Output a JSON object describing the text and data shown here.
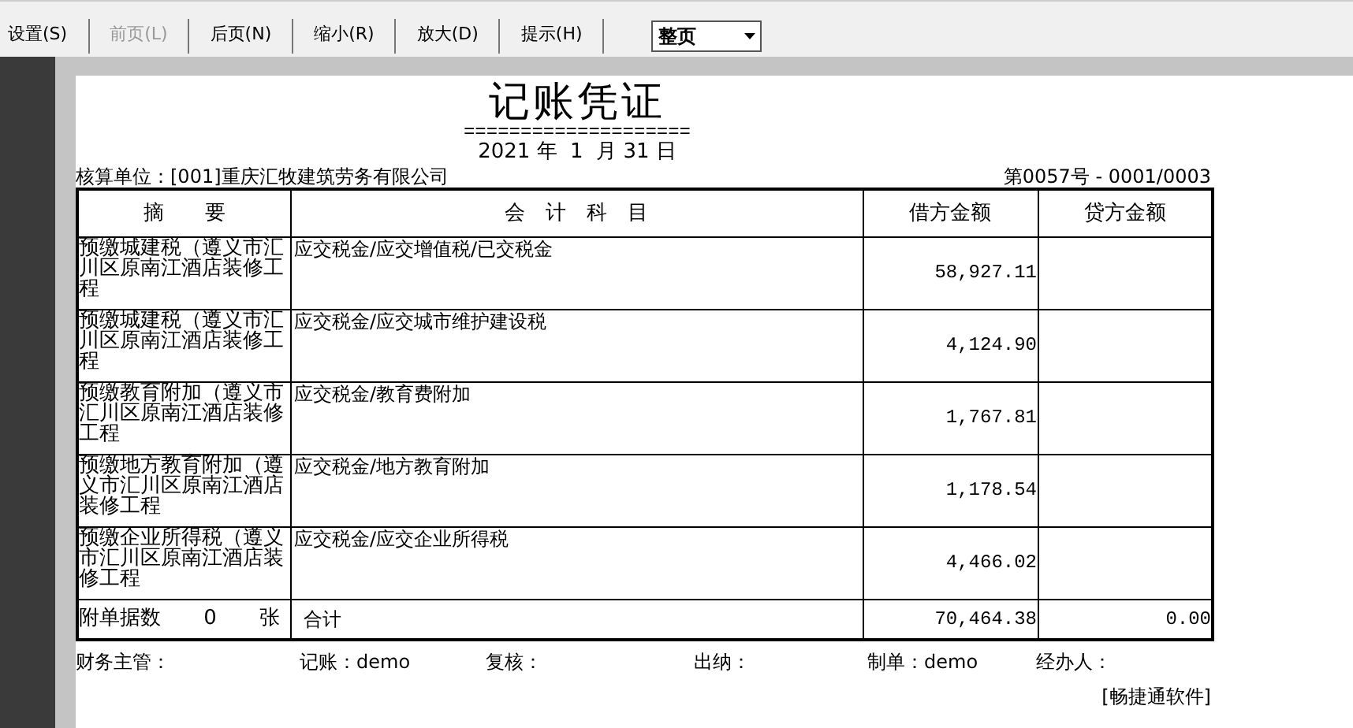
{
  "toolbar": {
    "buttons": [
      {
        "label": "设置(S)",
        "disabled": false
      },
      {
        "label": "前页(L)",
        "disabled": true
      },
      {
        "label": "后页(N)",
        "disabled": false
      },
      {
        "label": "缩小(R)",
        "disabled": false
      },
      {
        "label": "放大(D)",
        "disabled": false
      },
      {
        "label": "提示(H)",
        "disabled": false
      }
    ],
    "zoom_select": {
      "value": "整页"
    }
  },
  "voucher": {
    "title": "记账凭证",
    "title_rule": "====================",
    "date": "2021 年  1  月 31 日",
    "unit": "核算单位：[001]重庆汇牧建筑劳务有限公司",
    "number": "第0057号 - 0001/0003",
    "columns": [
      "摘　　要",
      "会　计　科　目",
      "借方金额",
      "贷方金额"
    ],
    "rows": [
      {
        "summary": "预缴城建税（遵义市汇川区原南江酒店装修工程",
        "account": "应交税金/应交增值税/已交税金",
        "debit": "58,927.11"
      },
      {
        "summary": "预缴城建税（遵义市汇川区原南江酒店装修工程",
        "account": "应交税金/应交城市维护建设税",
        "debit": "4,124.90"
      },
      {
        "summary": "预缴教育附加（遵义市汇川区原南江酒店装修工程",
        "account": "应交税金/教育费附加",
        "debit": "1,767.81"
      },
      {
        "summary": "预缴地方教育附加（遵义市汇川区原南江酒店装修工程",
        "account": "应交税金/地方教育附加",
        "debit": "1,178.54"
      },
      {
        "summary": "预缴企业所得税（遵义市汇川区原南江酒店装修工程",
        "account": "应交税金/应交企业所得税",
        "debit": "4,466.02"
      }
    ],
    "totals": {
      "attachments_label": "附单据数",
      "attachments_count": "0",
      "attachments_unit": "张",
      "label": "合计",
      "debit": "70,464.38",
      "credit": "0.00"
    },
    "signatures": [
      "财务主管：",
      "记账：demo",
      "复核：",
      "出纳：",
      "制单：demo",
      "经办人："
    ],
    "software": "[畅捷通软件]"
  }
}
